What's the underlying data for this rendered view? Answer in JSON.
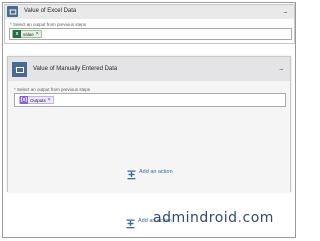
{
  "card1": {
    "title": "Value of Excel Data",
    "menu": "...",
    "field_label": "* Select an output from previous steps",
    "token": {
      "label": "value",
      "icon": "excel-icon",
      "remove": "×",
      "color": "#1e7145"
    }
  },
  "card2": {
    "title": "Value of Manually Entered Data",
    "menu": "...",
    "field_label": "* Select an output from previous steps",
    "token": {
      "label": "Outputs",
      "icon": "variable-icon",
      "remove": "×",
      "color": "#8a63d2"
    },
    "add_action": "Add an action"
  },
  "outer": {
    "add_action": "Add an action"
  },
  "watermark": {
    "brand_pre": "admindroid",
    "brand_dot": ".",
    "brand_post": "com"
  },
  "colors": {
    "loop_blue": "#486991",
    "link_blue": "#3b6aa0"
  }
}
